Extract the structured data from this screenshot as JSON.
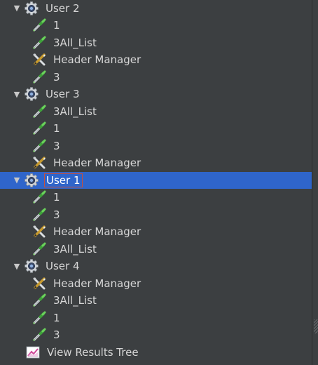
{
  "tree": {
    "nodes": [
      {
        "label": "User 2",
        "type": "thread-group",
        "level": 0,
        "expanded": true
      },
      {
        "label": "1",
        "type": "sampler",
        "level": 1
      },
      {
        "label": "3All_List",
        "type": "sampler",
        "level": 1
      },
      {
        "label": "Header Manager",
        "type": "config",
        "level": 1
      },
      {
        "label": "3",
        "type": "sampler",
        "level": 1
      },
      {
        "label": "User 3",
        "type": "thread-group",
        "level": 0,
        "expanded": true
      },
      {
        "label": "3All_List",
        "type": "sampler",
        "level": 1
      },
      {
        "label": "1",
        "type": "sampler",
        "level": 1
      },
      {
        "label": "3",
        "type": "sampler",
        "level": 1
      },
      {
        "label": "Header Manager",
        "type": "config",
        "level": 1
      },
      {
        "label": "User 1",
        "type": "thread-group",
        "level": 0,
        "expanded": true,
        "selected": true
      },
      {
        "label": "1",
        "type": "sampler",
        "level": 1
      },
      {
        "label": "3",
        "type": "sampler",
        "level": 1
      },
      {
        "label": "Header Manager",
        "type": "config",
        "level": 1
      },
      {
        "label": "3All_List",
        "type": "sampler",
        "level": 1
      },
      {
        "label": "User 4",
        "type": "thread-group",
        "level": 0,
        "expanded": true
      },
      {
        "label": "Header Manager",
        "type": "config",
        "level": 1
      },
      {
        "label": "3All_List",
        "type": "sampler",
        "level": 1
      },
      {
        "label": "1",
        "type": "sampler",
        "level": 1
      },
      {
        "label": "3",
        "type": "sampler",
        "level": 1
      },
      {
        "label": "View Results Tree",
        "type": "listener",
        "level": 0
      }
    ]
  },
  "colors": {
    "background": "#3c3f41",
    "selection": "#2f65ca",
    "text": "#d6d6d6",
    "focus_border": "#c6503d"
  },
  "icons": {
    "thread-group": "gear-icon",
    "sampler": "pipette-icon",
    "config": "wrench-screwdriver-icon",
    "listener": "results-tree-icon",
    "expanded": "triangle-down-icon"
  }
}
